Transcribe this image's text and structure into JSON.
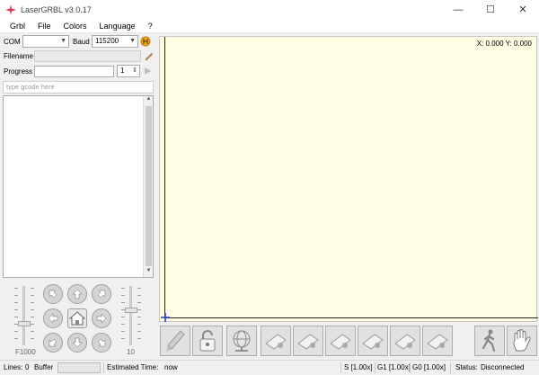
{
  "window": {
    "title": "LaserGRBL v3.0.17",
    "minimize": "—",
    "maximize": "☐",
    "close": "✕"
  },
  "menu": [
    "Grbl",
    "File",
    "Colors",
    "Language",
    "?"
  ],
  "connection": {
    "com_label": "COM",
    "com_value": "",
    "baud_label": "Baud",
    "baud_value": "115200"
  },
  "file": {
    "filename_label": "Filename",
    "filename_value": ""
  },
  "progress": {
    "label": "Progress",
    "passes": "1"
  },
  "gcode": {
    "placeholder": "type gcode here"
  },
  "jog": {
    "feed_label": "F1000",
    "step_label": "10"
  },
  "canvas": {
    "coordinates": "X: 0.000 Y: 0.000",
    "background": "#fffee4"
  },
  "status": {
    "lines_label": "Lines:",
    "lines_value": "0",
    "buffer_label": "Buffer",
    "estimated_label": "Estimated Time:",
    "estimated_value": "now",
    "s_override": "S [1.00x]",
    "g1_override": "G1 [1.00x]",
    "g0_override": "G0 [1.00x]",
    "status_label": "Status:",
    "status_value": "Disconnected"
  },
  "icons": [
    "lasergrbl-logo-icon",
    "connect-icon",
    "edit-icon",
    "play-icon",
    "jog-arrow-icons",
    "home-icon",
    "unlock-icon",
    "globe-icon",
    "user-button-icons",
    "walk-icon",
    "stop-hand-icon"
  ]
}
